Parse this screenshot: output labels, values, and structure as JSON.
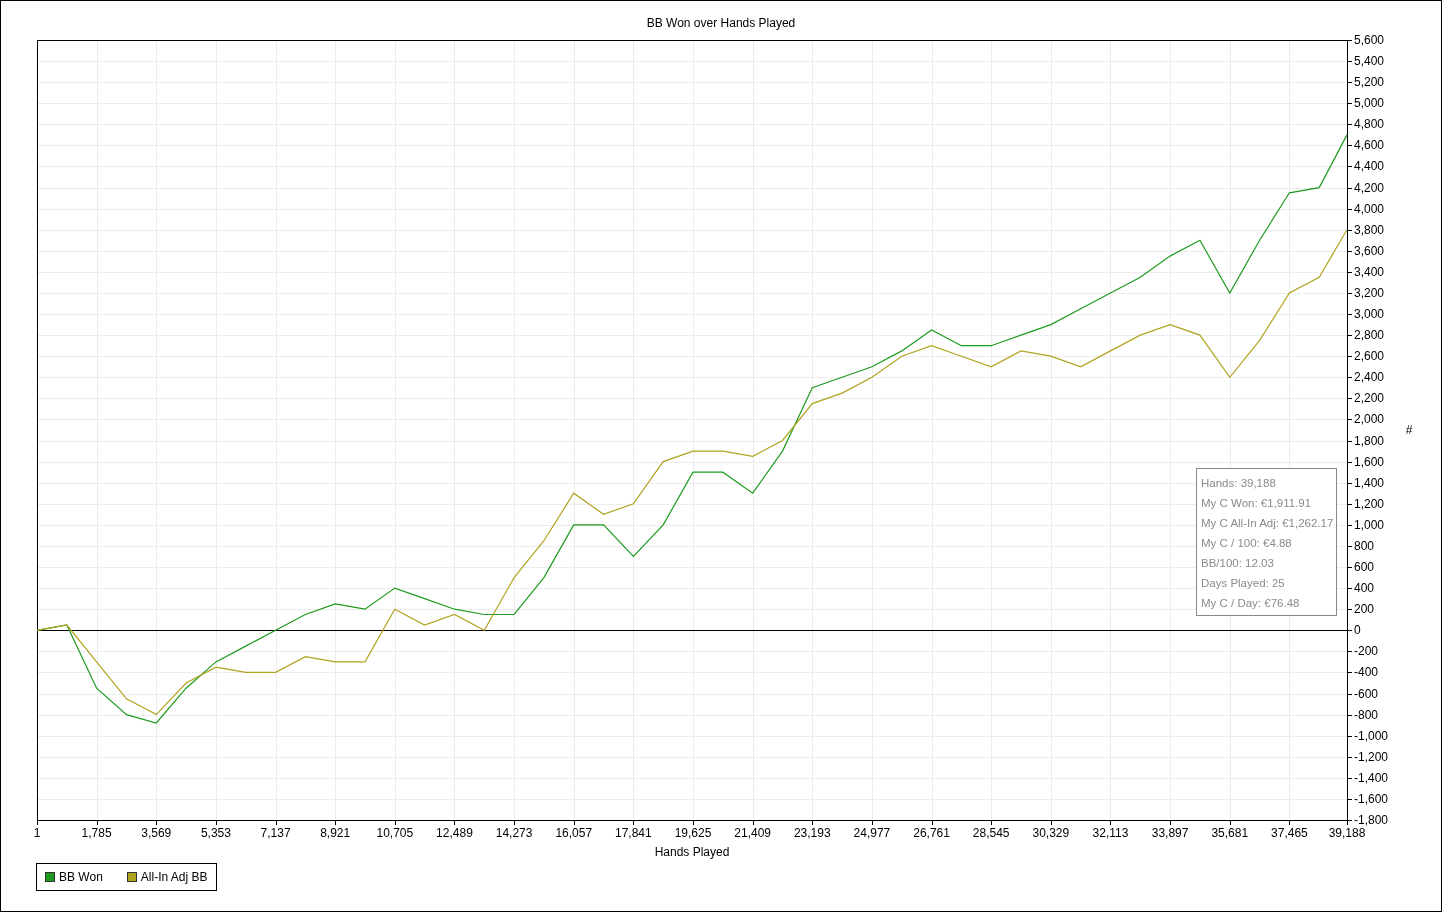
{
  "chart": {
    "chart_data": {
      "type": "line",
      "title": "BB Won over Hands Played",
      "xlabel": "Hands Played",
      "ylabel": "#",
      "grid": true,
      "x": [
        1,
        893,
        1785,
        2677,
        3569,
        4461,
        5353,
        6245,
        7137,
        8029,
        8921,
        9813,
        10705,
        11597,
        12489,
        13381,
        14273,
        15165,
        16057,
        16949,
        17841,
        18733,
        19625,
        20517,
        21409,
        22301,
        23193,
        24085,
        24977,
        25869,
        26761,
        27653,
        28545,
        29437,
        30329,
        31221,
        32113,
        33005,
        33897,
        34789,
        35681,
        36573,
        37465,
        38357,
        39188
      ],
      "series": [
        {
          "name": "BB Won",
          "color": "#1f9a1f",
          "values": [
            0,
            50,
            -550,
            -800,
            -880,
            -550,
            -300,
            -150,
            0,
            150,
            250,
            200,
            400,
            300,
            200,
            150,
            150,
            500,
            1000,
            1000,
            700,
            1000,
            1500,
            1500,
            1300,
            1700,
            2300,
            2400,
            2500,
            2650,
            2850,
            2700,
            2700,
            2800,
            2900,
            3050,
            3200,
            3350,
            3550,
            3700,
            3200,
            3700,
            4150,
            4200,
            4700
          ]
        },
        {
          "name": "All-In Adj BB",
          "color": "#b0a31f",
          "values": [
            0,
            50,
            -300,
            -650,
            -800,
            -500,
            -350,
            -400,
            -400,
            -250,
            -300,
            -300,
            200,
            50,
            150,
            0,
            500,
            850,
            1300,
            1100,
            1200,
            1600,
            1700,
            1700,
            1650,
            1800,
            2150,
            2250,
            2400,
            2600,
            2700,
            2600,
            2500,
            2650,
            2600,
            2500,
            2650,
            2800,
            2900,
            2800,
            2400,
            2750,
            3200,
            3350,
            3800
          ]
        }
      ],
      "xlim": [
        1,
        39188
      ],
      "ylim": [
        -1800,
        5600
      ],
      "xticks": [
        1,
        {
          "value": 1785,
          "label": "1,785"
        },
        {
          "value": 3569,
          "label": "3,569"
        },
        {
          "value": 5353,
          "label": "5,353"
        },
        {
          "value": 7137,
          "label": "7,137"
        },
        {
          "value": 8921,
          "label": "8,921"
        },
        {
          "value": 10705,
          "label": "10,705"
        },
        {
          "value": 12489,
          "label": "12,489"
        },
        {
          "value": 14273,
          "label": "14,273"
        },
        {
          "value": 16057,
          "label": "16,057"
        },
        {
          "value": 17841,
          "label": "17,841"
        },
        {
          "value": 19625,
          "label": "19,625"
        },
        {
          "value": 21409,
          "label": "21,409"
        },
        {
          "value": 23193,
          "label": "23,193"
        },
        {
          "value": 24977,
          "label": "24,977"
        },
        {
          "value": 26761,
          "label": "26,761"
        },
        {
          "value": 28545,
          "label": "28,545"
        },
        {
          "value": 30329,
          "label": "30,329"
        },
        {
          "value": 32113,
          "label": "32,113"
        },
        {
          "value": 33897,
          "label": "33,897"
        },
        {
          "value": 35681,
          "label": "35,681"
        },
        {
          "value": 37465,
          "label": "37,465"
        },
        {
          "value": 39188,
          "label": "39,188"
        }
      ],
      "yticks": [
        {
          "value": -1800,
          "label": "-1,800"
        },
        {
          "value": -1600,
          "label": "-1,600"
        },
        {
          "value": -1400,
          "label": "-1,400"
        },
        {
          "value": -1200,
          "label": "-1,200"
        },
        {
          "value": -1000,
          "label": "-1,000"
        },
        -800,
        -600,
        -400,
        -200,
        0,
        200,
        400,
        600,
        800,
        {
          "value": 1000,
          "label": "1,000"
        },
        {
          "value": 1200,
          "label": "1,200"
        },
        {
          "value": 1400,
          "label": "1,400"
        },
        {
          "value": 1600,
          "label": "1,600"
        },
        {
          "value": 1800,
          "label": "1,800"
        },
        {
          "value": 2000,
          "label": "2,000"
        },
        {
          "value": 2200,
          "label": "2,200"
        },
        {
          "value": 2400,
          "label": "2,400"
        },
        {
          "value": 2600,
          "label": "2,600"
        },
        {
          "value": 2800,
          "label": "2,800"
        },
        {
          "value": 3000,
          "label": "3,000"
        },
        {
          "value": 3200,
          "label": "3,200"
        },
        {
          "value": 3400,
          "label": "3,400"
        },
        {
          "value": 3600,
          "label": "3,600"
        },
        {
          "value": 3800,
          "label": "3,800"
        },
        {
          "value": 4000,
          "label": "4,000"
        },
        {
          "value": 4200,
          "label": "4,200"
        },
        {
          "value": 4400,
          "label": "4,400"
        },
        {
          "value": 4600,
          "label": "4,600"
        },
        {
          "value": 4800,
          "label": "4,800"
        },
        {
          "value": 5000,
          "label": "5,000"
        },
        {
          "value": 5200,
          "label": "5,200"
        },
        {
          "value": 5400,
          "label": "5,400"
        },
        {
          "value": 5600,
          "label": "5,600"
        }
      ]
    }
  },
  "stats": [
    "Hands: 39,188",
    "My C Won: €1,911.91",
    "My C All-In Adj: €1,262.17",
    "My C / 100: €4.88",
    "BB/100: 12.03",
    "Days Played: 25",
    "My C / Day: €76.48"
  ]
}
